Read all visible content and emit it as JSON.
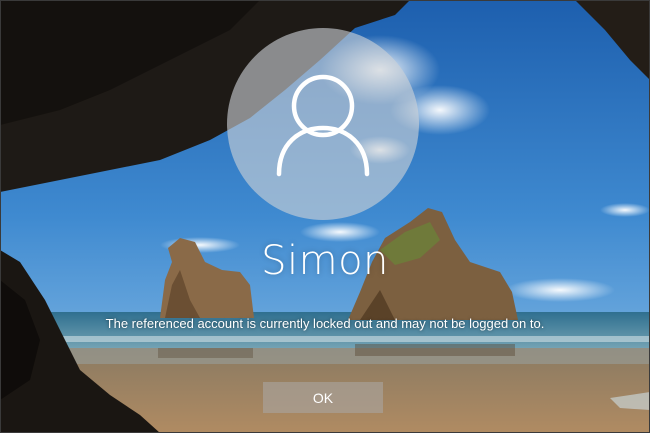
{
  "user": {
    "name": "Simon",
    "avatar_icon": "user-silhouette-icon"
  },
  "message": {
    "text": "The referenced account is currently locked out and may not be logged on to."
  },
  "dialog": {
    "ok_label": "OK"
  },
  "colors": {
    "sky": "#2b6fb5",
    "avatar_circle": "#cdd2d7",
    "button": "#aaa5a0",
    "text": "#ffffff"
  }
}
